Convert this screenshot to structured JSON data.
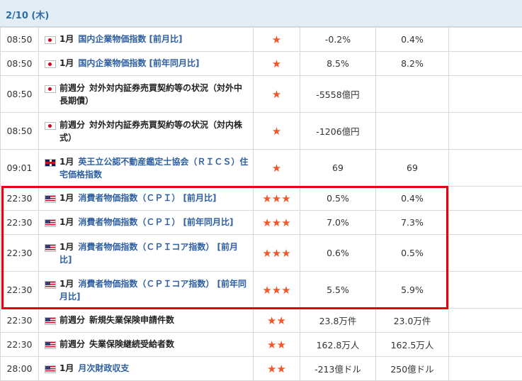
{
  "date": "2/10 (木)",
  "rows": [
    {
      "time": "08:50",
      "flag": "jp",
      "month": "1月",
      "prefix": "",
      "name": "国内企業物価指数 [前月比]",
      "link": true,
      "stars": "★",
      "prev": "-0.2%",
      "forecast": "0.4%",
      "h": 34
    },
    {
      "time": "08:50",
      "flag": "jp",
      "month": "1月",
      "prefix": "",
      "name": "国内企業物価指数 [前年同月比]",
      "link": true,
      "stars": "★",
      "prev": "8.5%",
      "forecast": "8.2%",
      "h": 34
    },
    {
      "time": "08:50",
      "flag": "jp",
      "month": "",
      "prefix": "前週分",
      "name": "対外対内証券売買契約等の状況（対外中長期債）",
      "link": false,
      "stars": "★",
      "prev": "-5558億円",
      "forecast": "",
      "h": 52
    },
    {
      "time": "08:50",
      "flag": "jp",
      "month": "",
      "prefix": "前週分",
      "name": "対外対内証券売買契約等の状況（対内株式）",
      "link": false,
      "stars": "★",
      "prev": "-1206億円",
      "forecast": "",
      "h": 52
    },
    {
      "time": "09:01",
      "flag": "uk",
      "month": "1月",
      "prefix": "",
      "name": "英王立公認不動産鑑定士協会（ＲＩＣＳ）住宅価格指数",
      "link": true,
      "stars": "★",
      "prev": "69",
      "forecast": "69",
      "h": 52
    },
    {
      "time": "22:30",
      "flag": "us",
      "month": "1月",
      "prefix": "",
      "name": "消費者物価指数（ＣＰＩ） [前月比]",
      "link": true,
      "stars": "★★★",
      "prev": "0.5%",
      "forecast": "0.4%",
      "h": 34
    },
    {
      "time": "22:30",
      "flag": "us",
      "month": "1月",
      "prefix": "",
      "name": "消費者物価指数（ＣＰＩ） [前年同月比]",
      "link": true,
      "stars": "★★★",
      "prev": "7.0%",
      "forecast": "7.3%",
      "h": 34
    },
    {
      "time": "22:30",
      "flag": "us",
      "month": "1月",
      "prefix": "",
      "name": "消費者物価指数（ＣＰＩコア指数） [前月比]",
      "link": true,
      "stars": "★★★",
      "prev": "0.6%",
      "forecast": "0.5%",
      "h": 52
    },
    {
      "time": "22:30",
      "flag": "us",
      "month": "1月",
      "prefix": "",
      "name": "消費者物価指数（ＣＰＩコア指数） [前年同月比]",
      "link": true,
      "stars": "★★★",
      "prev": "5.5%",
      "forecast": "5.9%",
      "h": 52
    },
    {
      "time": "22:30",
      "flag": "us",
      "month": "",
      "prefix": "前週分",
      "name": "新規失業保険申請件数",
      "link": false,
      "stars": "★★",
      "prev": "23.8万件",
      "forecast": "23.0万件",
      "h": 34
    },
    {
      "time": "22:30",
      "flag": "us",
      "month": "",
      "prefix": "前週分",
      "name": "失業保険継続受給者数",
      "link": false,
      "stars": "★★",
      "prev": "162.8万人",
      "forecast": "162.5万人",
      "h": 34
    },
    {
      "time": "28:00",
      "flag": "us",
      "month": "1月",
      "prefix": "",
      "name": "月次財政収支",
      "link": true,
      "stars": "★★",
      "prev": "-213億ドル",
      "forecast": "250億ドル",
      "h": 34
    }
  ]
}
